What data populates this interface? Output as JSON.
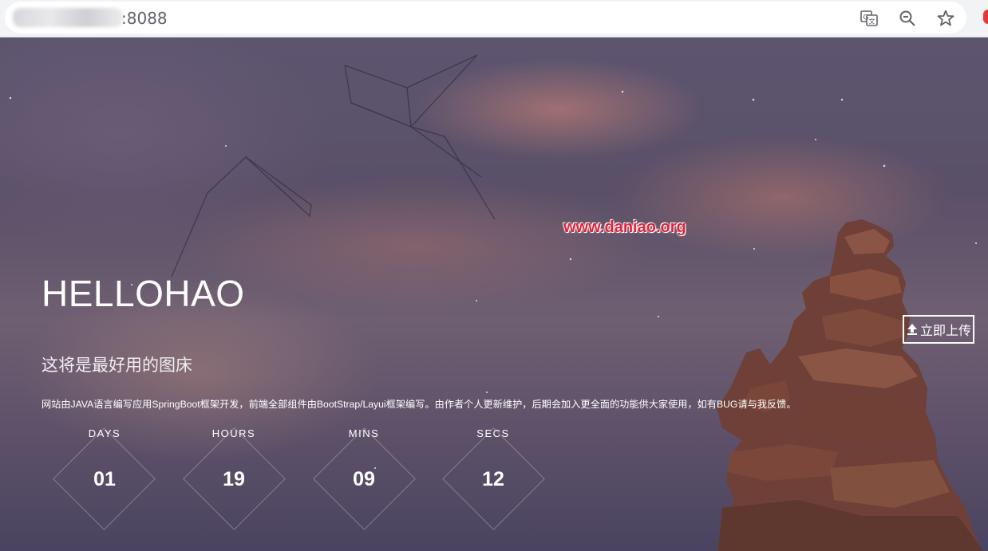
{
  "browser": {
    "url_suffix": ":8088",
    "icons": [
      "translate-icon",
      "zoom-icon",
      "bookmark-star-icon"
    ]
  },
  "watermark": "www.daniao.org",
  "hero": {
    "title": "HELLOHAO",
    "subtitle": "这将是最好用的图床",
    "description": "网站由JAVA语言编写应用SpringBoot框架开发，前端全部组件由BootStrap/Layui框架编写。由作者个人更新维护，后期会加入更全面的功能供大家使用，如有BUG请与我反馈。",
    "upload_button": "立即上传"
  },
  "countdown": [
    {
      "label": "DAYS",
      "value": "01"
    },
    {
      "label": "HOURS",
      "value": "19"
    },
    {
      "label": "MINS",
      "value": "09"
    },
    {
      "label": "SECS",
      "value": "12"
    }
  ],
  "colors": {
    "watermark": "#e0213a",
    "rock": "#7a4a3f",
    "sky": "#5a5068"
  }
}
